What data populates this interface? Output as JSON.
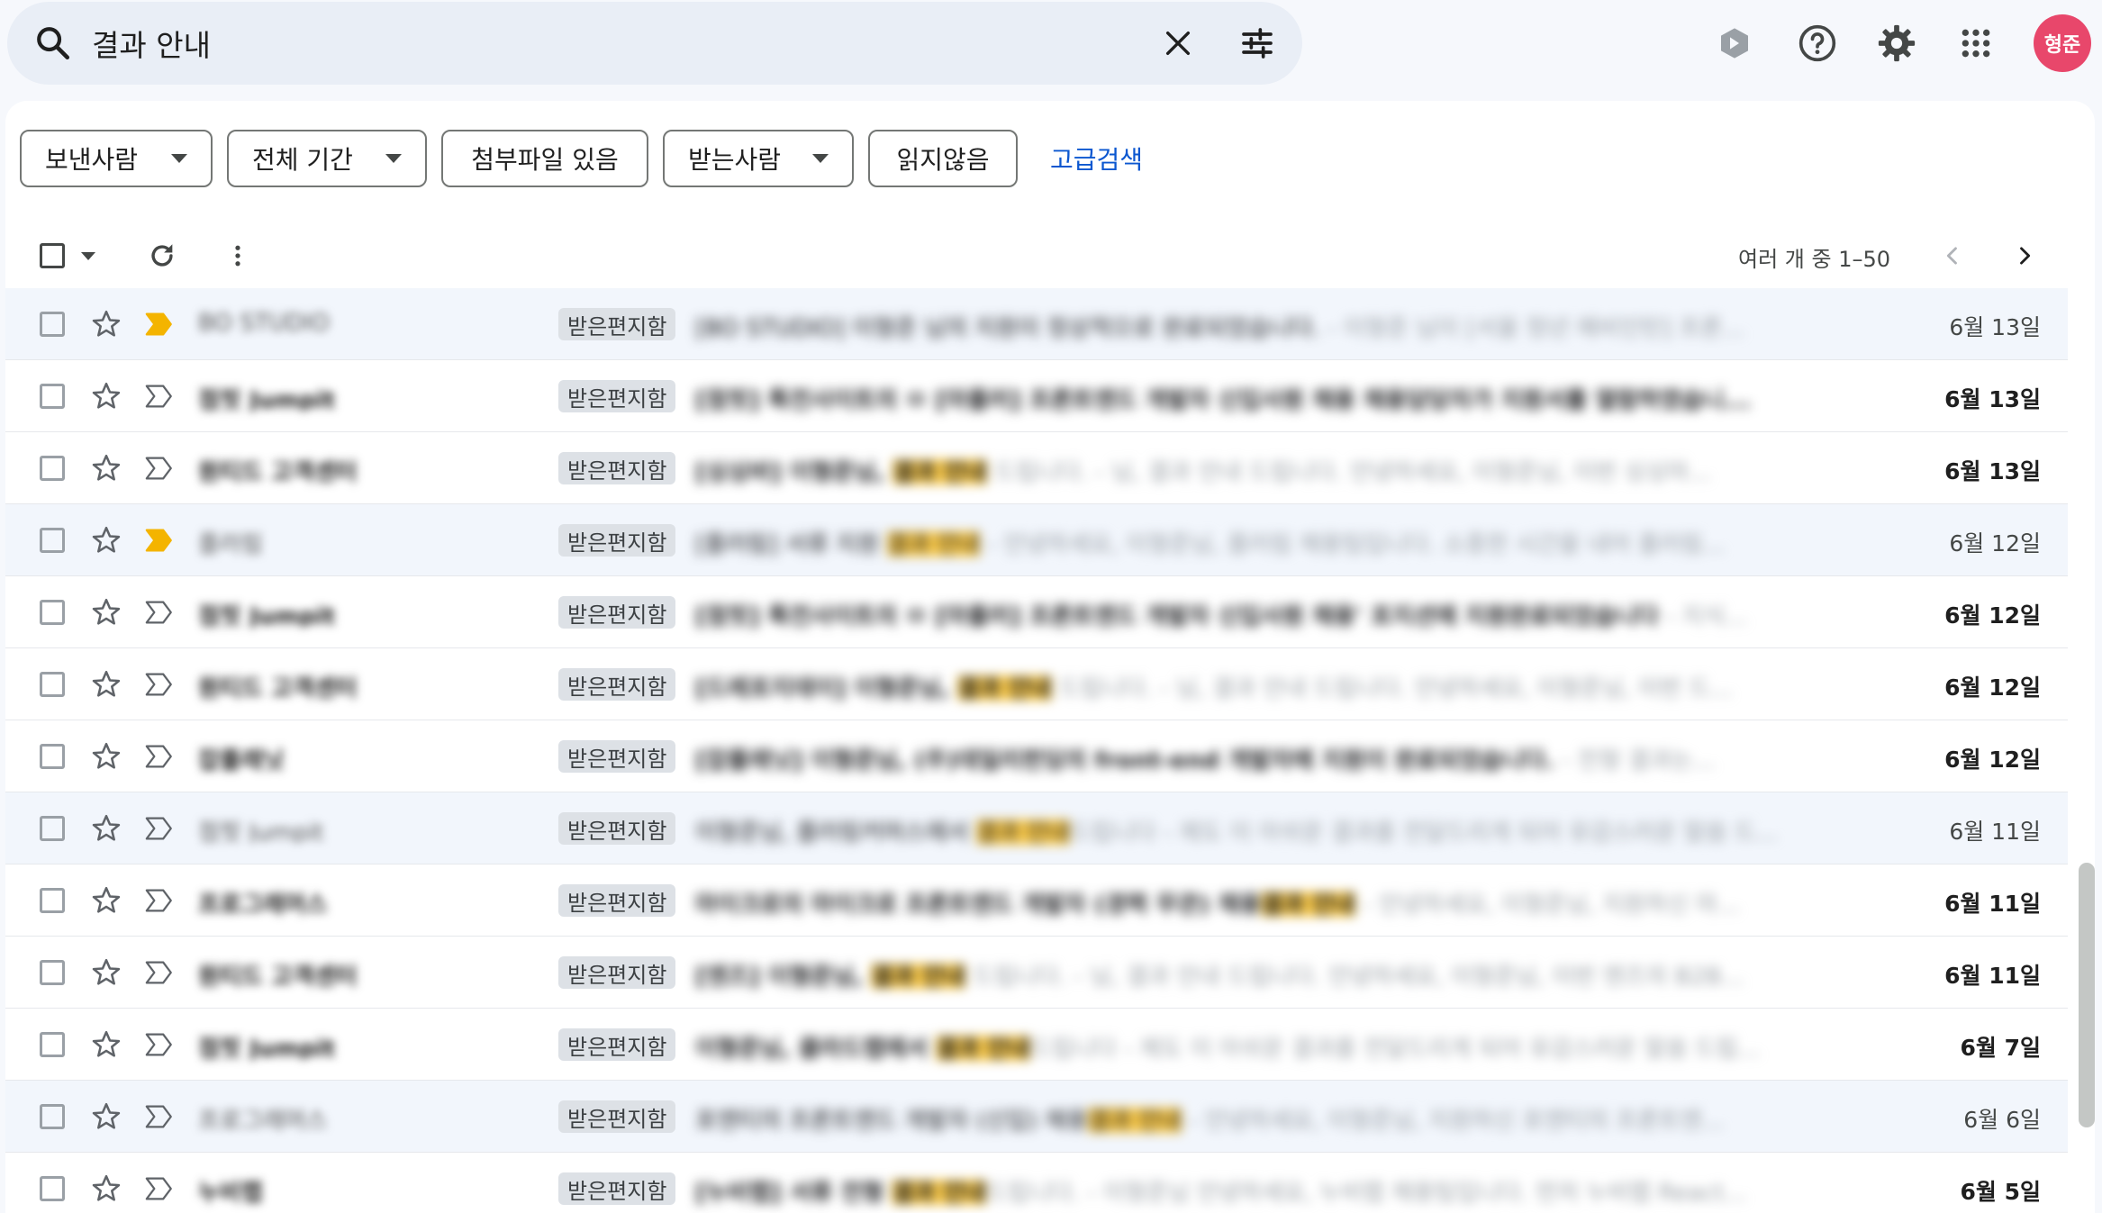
{
  "search": {
    "query": "결과 안내"
  },
  "header": {
    "avatar_text": "형준"
  },
  "filters": {
    "sender": "보낸사람",
    "period": "전체 기간",
    "has_attachment": "첨부파일 있음",
    "recipient": "받는사람",
    "unread": "읽지않음",
    "advanced": "고급검색"
  },
  "toolbar": {
    "range": "여러 개 중 1–50"
  },
  "colors": {
    "accent": "#0b57d0",
    "highlight": "#f9c94a",
    "important": "#f4b400",
    "avatar": "#e8476b"
  },
  "emails": [
    {
      "sender": "BO STUDIO",
      "label": "받은편지함",
      "subject": "[BO STUDIO] 이형준 님의 지원이 정상적으로 완료되었습니다.",
      "hl": "",
      "rest": " - 이형준 님이 [서울 청년 예비인턴] 프론...",
      "date": "6월 13일",
      "unread": false,
      "important": true
    },
    {
      "sender": "점핏 Jumpit",
      "label": "받은편지함",
      "subject": "[점핏] 특전사이트의 ㅁ [마플러] 프론트엔드 개발자 신입사원 채용 채용담당자가 지원서를 열람하였습니...",
      "hl": "",
      "rest": "",
      "date": "6월 13일",
      "unread": true,
      "important": false
    },
    {
      "sender": "원티드 고객센터",
      "label": "받은편지함",
      "subject": "[싱싱바] 이형준님, ",
      "hl": "결과 안내",
      "rest": " 드립니다. - 님, 결과 안내 드립니다. 안녕하세요, 이형준님, 이번 싱싱마...",
      "date": "6월 13일",
      "unread": true,
      "important": false
    },
    {
      "sender": "플러림",
      "label": "받은편지함",
      "subject": "[플러림] 서류 지원 ",
      "hl": "결과 안내",
      "rest": " - 안녕하세요, 이형준님, 플러림 채용팀입니다. 소중한 시간을 내어 플러림...",
      "date": "6월 12일",
      "unread": false,
      "important": true
    },
    {
      "sender": "점핏 Jumpit",
      "label": "받은편지함",
      "subject": "[점핏] 특전사이트의 ㅁ [마플러] 프론트엔드 개발자 신입사원 채용' 포지션에 지원완료되었습니다",
      "hl": "",
      "rest": " - 지식...",
      "date": "6월 12일",
      "unread": true,
      "important": false
    },
    {
      "sender": "원티드 고객센터",
      "label": "받은편지함",
      "subject": "[드레포지데이] 이형준님, ",
      "hl": "결과 안내",
      "rest": " 드립니다. - 님, 결과 안내 드립니다. 안녕하세요, 이형준님, 이번 드...",
      "date": "6월 12일",
      "unread": true,
      "important": false
    },
    {
      "sender": "잡플래닛",
      "label": "받은편지함",
      "subject": "[잡플래닛] 이형준님, (주)데일리펀딩의 front-end 개발자에 지원이 완료되었습니다.",
      "hl": "",
      "rest": " - 전형 결과는...",
      "date": "6월 12일",
      "unread": true,
      "important": false
    },
    {
      "sender": "점핏 Jumpit",
      "label": "받은편지함",
      "subject": "이형준님, 플러링커머스에서 ",
      "hl": "결과 안내",
      "rest": "드립니다 - 제도 이 아쉬운 결과를 전달드리게 되어 유감스러운 말씀 드...",
      "date": "6월 11일",
      "unread": false,
      "important": false
    },
    {
      "sender": "프로그래머스",
      "label": "받은편지함",
      "subject": "마이크로의 마이크로 프론트엔드 개발자 (경력 무관) 채용",
      "hl": "결과 안내",
      "rest": " - 안녕하세요, 이형준님, 지원하신 마...",
      "date": "6월 11일",
      "unread": true,
      "important": false
    },
    {
      "sender": "원티드 고객센터",
      "label": "받은편지함",
      "subject": "[엔즈] 이형준님, ",
      "hl": "결과 안내",
      "rest": " 드립니다. - 님, 결과 안내 드립니다. 안녕하세요, 이형준님, 이번 엔즈의 B2B...",
      "date": "6월 11일",
      "unread": true,
      "important": false
    },
    {
      "sender": "점핏 Jumpit",
      "label": "받은편지함",
      "subject": "이형준님, 클라드랩에서 ",
      "hl": "결과 안내",
      "rest": "드립니다 - 제도 이 아쉬운 결과를 전달드리게 되어 유감스러운 말씀 드립...",
      "date": "6월 7일",
      "unread": true,
      "important": false
    },
    {
      "sender": "프로그래머스",
      "label": "받은편지함",
      "subject": "포엔티의 프론트엔드 개발자 (신입) 채용",
      "hl": "결과 안내",
      "rest": " - 안녕하세요, 이형준님, 지원하신 포엔티의 프론트엔...",
      "date": "6월 6일",
      "unread": false,
      "important": false
    },
    {
      "sender": "누비랩",
      "label": "받은편지함",
      "subject": "[누비랩] 서류 전형 ",
      "hl": "결과 안내",
      "rest": "드립니다. - 이형준님 안녕하세요, 누비랩 채용팀입니다. 먼저 누비랩 React...",
      "date": "6월 5일",
      "unread": true,
      "important": false
    }
  ]
}
